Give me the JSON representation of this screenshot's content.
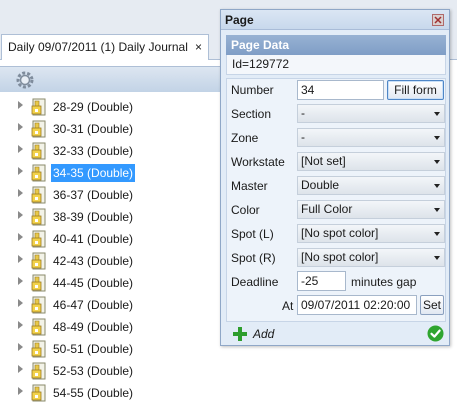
{
  "document_tab": {
    "label": "Daily 09/07/2011 (1) Daily Journal",
    "close_glyph": "×"
  },
  "toolbar": {
    "icon": "gear-icon"
  },
  "tree": {
    "items": [
      {
        "label": "28-29  (Double)",
        "selected": false
      },
      {
        "label": "30-31  (Double)",
        "selected": false
      },
      {
        "label": "32-33  (Double)",
        "selected": false
      },
      {
        "label": "34-35  (Double)",
        "selected": true
      },
      {
        "label": "36-37  (Double)",
        "selected": false
      },
      {
        "label": "38-39  (Double)",
        "selected": false
      },
      {
        "label": "40-41  (Double)",
        "selected": false
      },
      {
        "label": "42-43  (Double)",
        "selected": false
      },
      {
        "label": "44-45  (Double)",
        "selected": false
      },
      {
        "label": "46-47  (Double)",
        "selected": false
      },
      {
        "label": "48-49  (Double)",
        "selected": false
      },
      {
        "label": "50-51  (Double)",
        "selected": false
      },
      {
        "label": "52-53  (Double)",
        "selected": false
      },
      {
        "label": "54-55  (Double)",
        "selected": false
      }
    ]
  },
  "panel": {
    "title": "Page",
    "close_glyph": "⊠",
    "section_title": "Page Data",
    "id_text": "Id=129772",
    "number": {
      "label": "Number",
      "value": "34",
      "button": "Fill form"
    },
    "section": {
      "label": "Section",
      "value": "-"
    },
    "zone": {
      "label": "Zone",
      "value": "-"
    },
    "workstate": {
      "label": "Workstate",
      "value": "[Not set]"
    },
    "master": {
      "label": "Master",
      "value": "Double"
    },
    "color": {
      "label": "Color",
      "value": "Full Color"
    },
    "spot_l": {
      "label": "Spot (L)",
      "value": "[No spot color]"
    },
    "spot_r": {
      "label": "Spot (R)",
      "value": "[No spot color]"
    },
    "deadline": {
      "label": "Deadline",
      "value": "-25",
      "unit": "minutes gap"
    },
    "at": {
      "label": "At",
      "value": "09/07/2011 02:20:00",
      "button": "Set"
    },
    "add_label": "Add"
  },
  "colors": {
    "selection": "#3399ff",
    "panel_header": "#7f9ec6",
    "add_green": "#2e9e2e",
    "ok_green": "#2fa52f"
  }
}
